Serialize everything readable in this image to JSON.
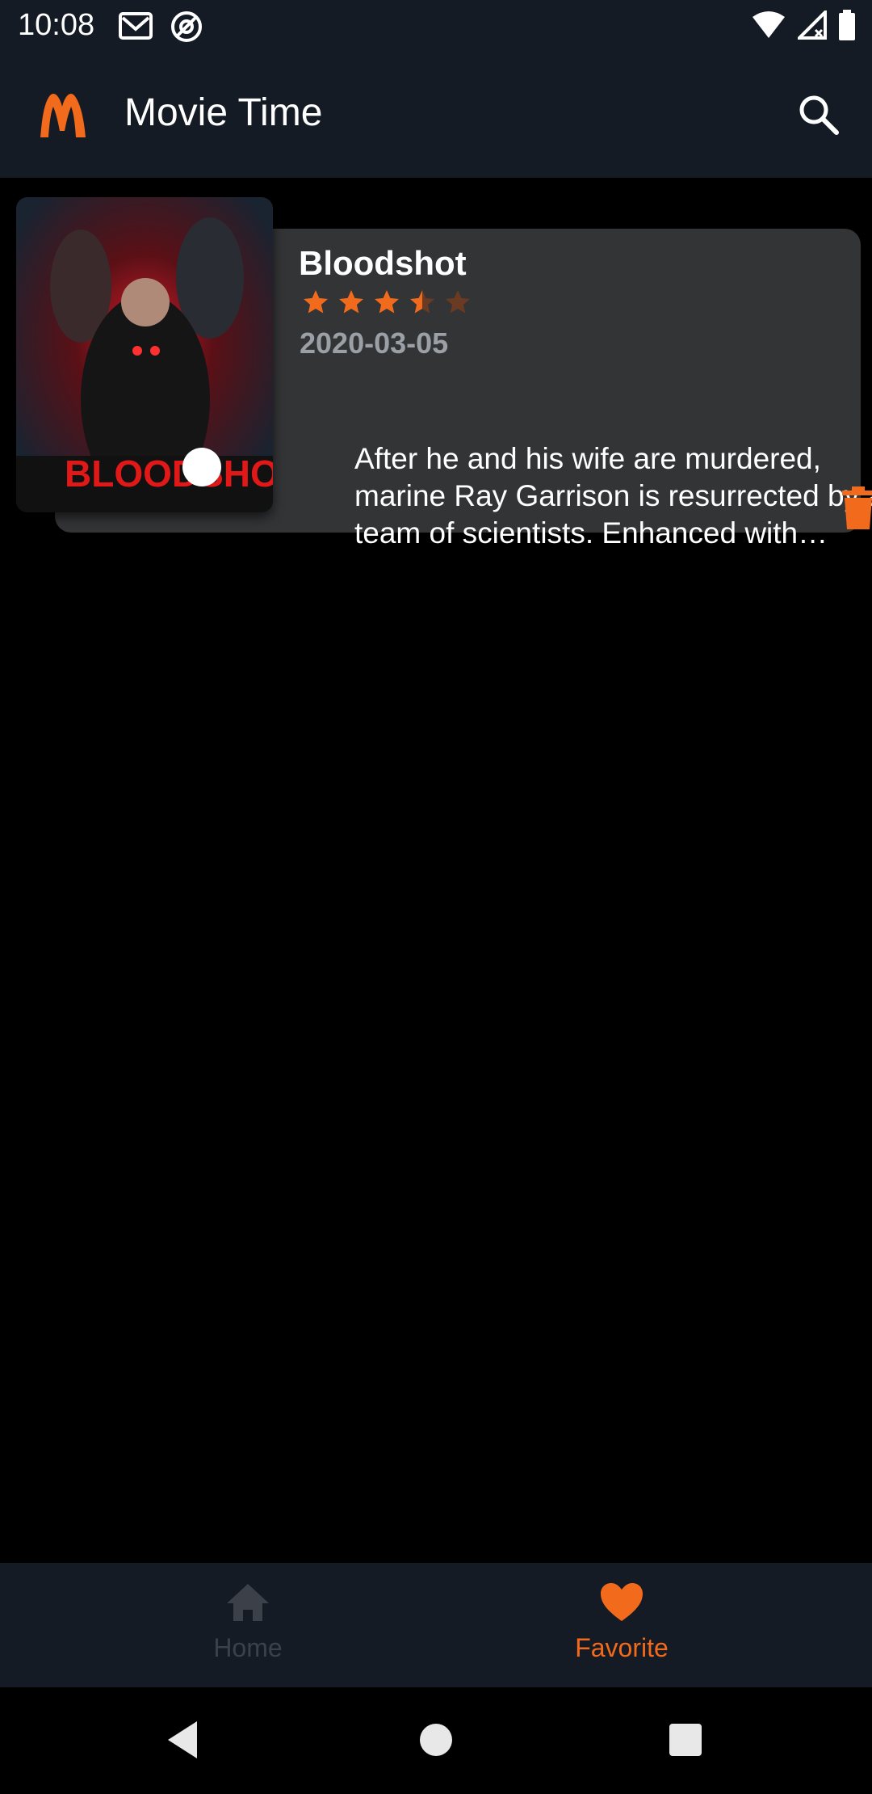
{
  "status_bar": {
    "time": "10:08"
  },
  "app_bar": {
    "title": "Movie Time",
    "logo_letter": "M"
  },
  "favorites": [
    {
      "title": "Bloodshot",
      "rating_stars": 3.5,
      "rating_max": 5,
      "release_date": "2020-03-05",
      "overview": "After he and his wife are murdered, marine Ray Garrison is resurrected by a team of scientists. Enhanced with nanotechnology, he becomes a superhuman, biotech killing machine—'Bloodshot'.",
      "poster_text": "BLOODSHOT"
    }
  ],
  "bottom_nav": {
    "home_label": "Home",
    "favorite_label": "Favorite",
    "active": "favorite"
  },
  "colors": {
    "accent": "#f26a1b",
    "bar_bg": "#151b24",
    "card_bg": "#333436",
    "inactive": "#3c4048"
  }
}
